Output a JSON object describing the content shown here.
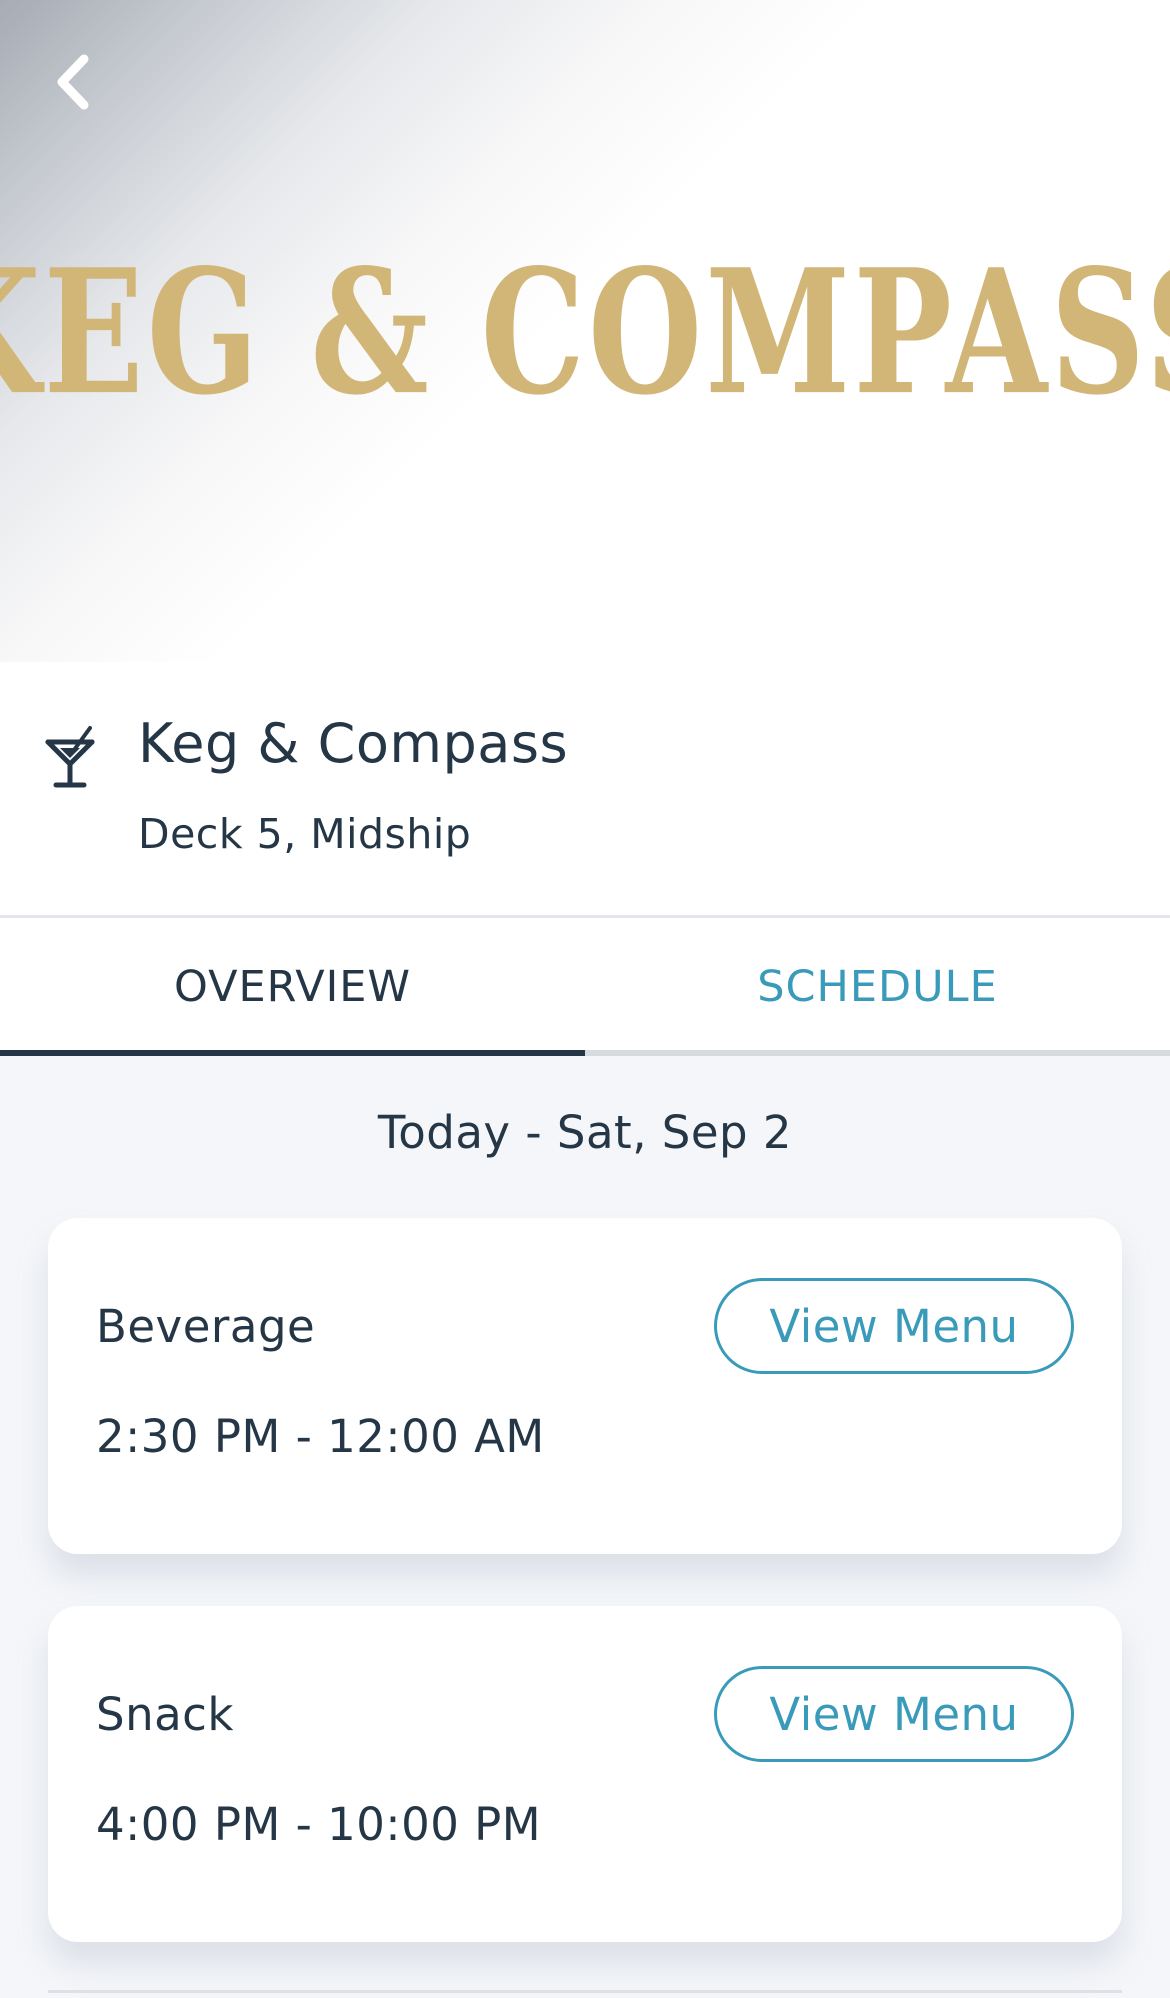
{
  "hero": {
    "logo_text": "KEG & COMPASS",
    "logo_color": "#d2b677",
    "back_icon": "chevron-left-icon"
  },
  "venue": {
    "icon": "cocktail-glass-icon",
    "name": "Keg & Compass",
    "location": "Deck 5, Midship"
  },
  "tabs": [
    {
      "label": "OVERVIEW",
      "active": true
    },
    {
      "label": "SCHEDULE",
      "active": false
    }
  ],
  "schedule": {
    "date_heading": "Today - Sat, Sep 2",
    "cards": [
      {
        "title": "Beverage",
        "hours": "2:30 PM - 12:00 AM",
        "button_label": "View Menu"
      },
      {
        "title": "Snack",
        "hours": "4:00 PM - 10:00 PM",
        "button_label": "View Menu"
      }
    ]
  },
  "colors": {
    "text_primary": "#253746",
    "accent": "#3a9ab9",
    "background": "#f4f6f9"
  }
}
